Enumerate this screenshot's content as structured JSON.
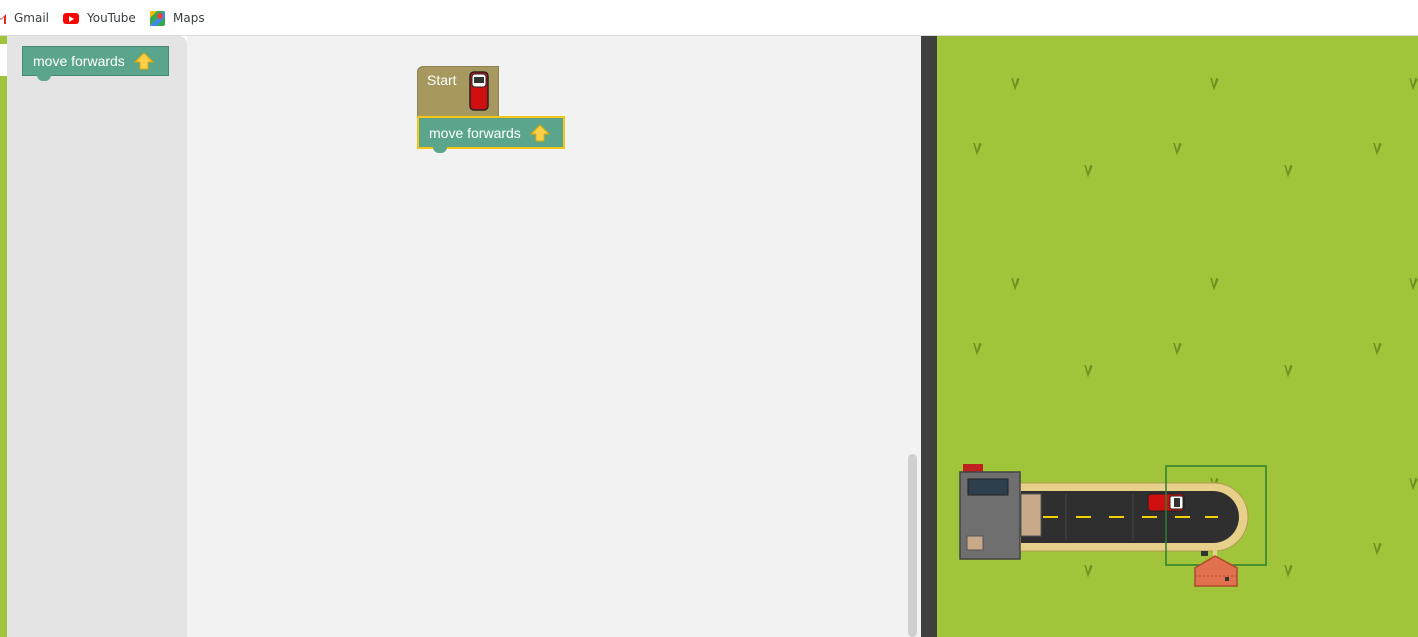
{
  "bookmarks": [
    {
      "label": "Gmail",
      "icon": "gmail-icon"
    },
    {
      "label": "YouTube",
      "icon": "youtube-icon"
    },
    {
      "label": "Maps",
      "icon": "maps-icon"
    }
  ],
  "toolbox": {
    "blocks": [
      {
        "label": "move forwards",
        "icon": "arrow-up-icon"
      }
    ]
  },
  "workspace": {
    "start_block": {
      "label": "Start",
      "icon": "red-van-icon"
    },
    "program": [
      {
        "label": "move forwards",
        "icon": "arrow-up-icon",
        "selected": true
      }
    ]
  },
  "map": {
    "elements": [
      "house-depot-icon",
      "road",
      "red-van-icon",
      "destination-house-icon",
      "target-highlight"
    ],
    "colors": {
      "grass": "#a0c43a",
      "road": "#2f2f2f",
      "road_line": "#f5d000",
      "highlight": "#2e7d32",
      "house": "#e2714f"
    }
  },
  "colors": {
    "move_block": "#5ba58c",
    "start_block": "#a6985e",
    "selection": "#f5c518",
    "toolbox_bg": "#e4e4e4",
    "workspace_bg": "#f2f2f2",
    "divider": "#404040"
  }
}
